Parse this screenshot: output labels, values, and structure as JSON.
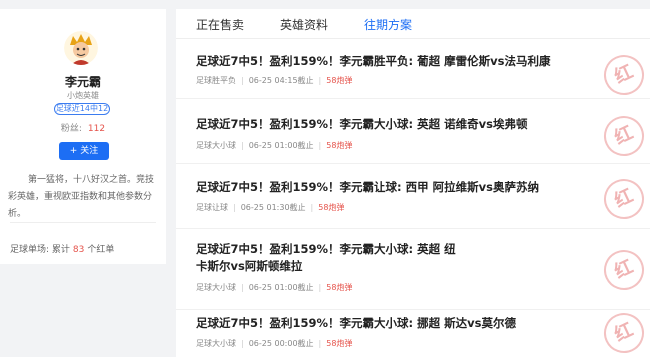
{
  "profile": {
    "name": "李元霸",
    "tag": "小炮英雄",
    "badge": "足球近14中12",
    "fans_label": "粉丝:",
    "fans_count": "112",
    "follow_label": "+ 关注",
    "description": "第一猛将，十八好汉之首。竞技彩英雄，重视欧亚指数和其他参数分析。",
    "record_prefix": "足球单场: 累计",
    "record_count": "83",
    "record_suffix": "个红单"
  },
  "tabs": [
    "正在售卖",
    "英雄资料",
    "往期方案"
  ],
  "active_tab": "往期方案",
  "items": [
    {
      "title": "足球近7中5！盈利159%！李元霸胜平负: 葡超 摩雷伦斯vs法马利康",
      "category": "足球胜平负",
      "time": "06-25 04:15截止",
      "price": "58炮弹",
      "stamp": "红"
    },
    {
      "title": "足球近7中5！盈利159%！李元霸大小球: 英超 诺维奇vs埃弗顿",
      "category": "足球大小球",
      "time": "06-25 01:00截止",
      "price": "58炮弹",
      "stamp": "红"
    },
    {
      "title": "足球近7中5！盈利159%！李元霸让球: 西甲 阿拉维斯vs奥萨苏纳",
      "category": "足球让球",
      "time": "06-25 01:30截止",
      "price": "58炮弹",
      "stamp": "红"
    },
    {
      "title": "足球近7中5！盈利159%！李元霸大小球: 英超 纽卡斯尔vs阿斯顿维拉",
      "category": "足球大小球",
      "time": "06-25 01:00截止",
      "price": "58炮弹",
      "stamp": "红"
    },
    {
      "title": "足球近7中5！盈利159%！李元霸大小球: 挪超 斯达vs莫尔德",
      "category": "足球大小球",
      "time": "06-25 00:00截止",
      "price": "58炮弹",
      "stamp": "红"
    }
  ],
  "colors": {
    "accent": "#1d6ef4",
    "price": "#e5534b",
    "stamp": "#f0b3b3"
  }
}
